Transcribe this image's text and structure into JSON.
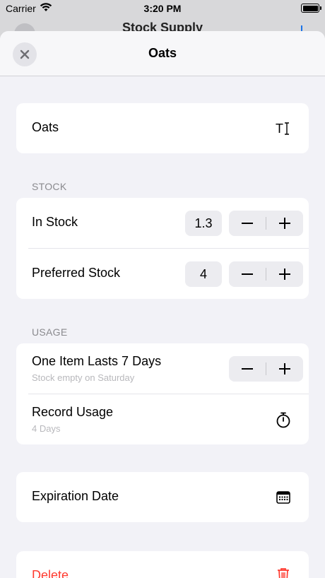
{
  "status_bar": {
    "carrier": "Carrier",
    "time": "3:20 PM"
  },
  "background_screen": {
    "title": "Stock Supply"
  },
  "sheet": {
    "title": "Oats",
    "name_field": {
      "value": "Oats"
    },
    "stock_section": {
      "header": "STOCK",
      "in_stock": {
        "label": "In Stock",
        "value": "1.3"
      },
      "preferred_stock": {
        "label": "Preferred Stock",
        "value": "4"
      }
    },
    "usage_section": {
      "header": "USAGE",
      "item_lasts": {
        "label": "One Item Lasts 7 Days",
        "subtitle": "Stock empty on Saturday"
      },
      "record_usage": {
        "label": "Record Usage",
        "subtitle": "4 Days"
      }
    },
    "expiration": {
      "label": "Expiration Date"
    },
    "delete": {
      "label": "Delete"
    }
  },
  "colors": {
    "destructive": "#ff3b30",
    "background": "#f2f2f7",
    "card": "#ffffff",
    "secondary_text": "#8a8a8e"
  },
  "icons": [
    "wifi-icon",
    "battery-icon",
    "close-icon",
    "text-format-icon",
    "minus-icon",
    "plus-icon",
    "stopwatch-icon",
    "calendar-icon",
    "trash-icon"
  ]
}
